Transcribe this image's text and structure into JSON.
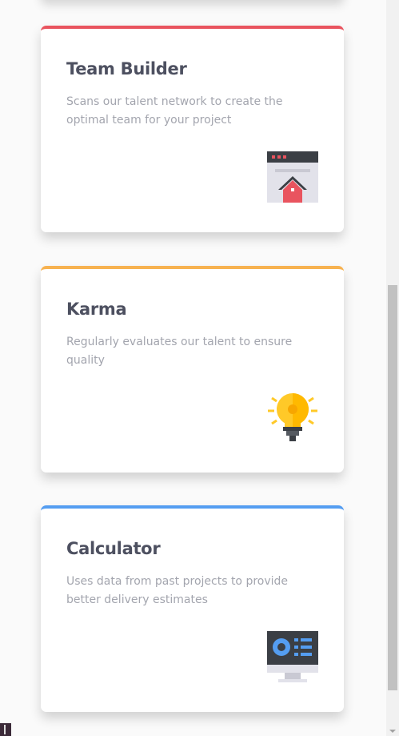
{
  "cards": [
    {
      "title": "Team Builder",
      "description": "Scans our talent network to create the optimal team for your project",
      "accent": "#e9545f",
      "icon": "team-builder-icon"
    },
    {
      "title": "Karma",
      "description": "Regularly evaluates our talent to ensure quality",
      "accent": "#f7b250",
      "icon": "karma-lightbulb-icon"
    },
    {
      "title": "Calculator",
      "description": "Uses data from past projects to provide better delivery estimates",
      "accent": "#549df1",
      "icon": "calculator-monitor-icon"
    }
  ]
}
